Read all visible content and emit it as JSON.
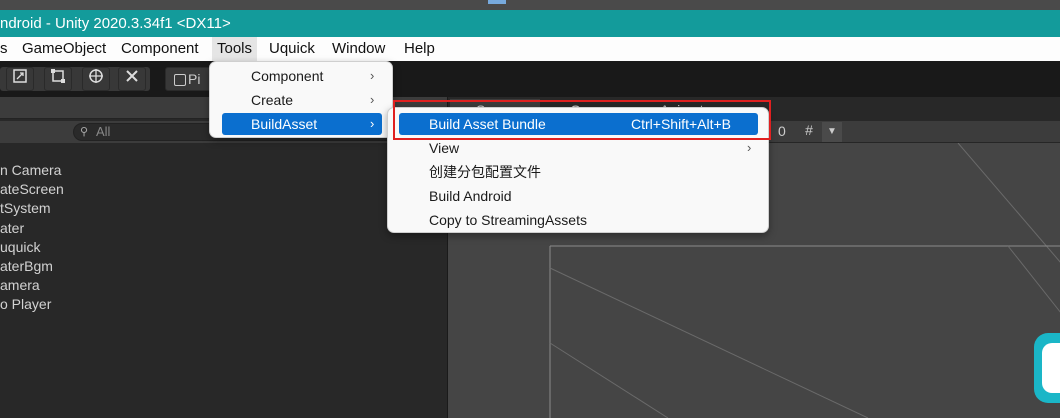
{
  "window": {
    "title": "ndroid - Unity 2020.3.34f1 <DX11>"
  },
  "menubar": {
    "items": [
      {
        "label": "s"
      },
      {
        "label": "GameObject"
      },
      {
        "label": "Component"
      },
      {
        "label": "Tools"
      },
      {
        "label": "Uquick"
      },
      {
        "label": "Window"
      },
      {
        "label": "Help"
      }
    ]
  },
  "toolbar": {
    "pivot_label": "Pi"
  },
  "hierarchy": {
    "search_placeholder": "All",
    "rows": [
      "n Camera",
      "ateScreen",
      "tSystem",
      "ater",
      "uquick",
      "aterBgm",
      "amera",
      "o Player"
    ]
  },
  "scene": {
    "tabs": [
      "Scene",
      "Game",
      "Animator"
    ],
    "gizmo_count": "0"
  },
  "tools_menu": {
    "items": [
      {
        "label": "Component",
        "arrow": "›"
      },
      {
        "label": "Create",
        "arrow": "›"
      },
      {
        "label": "BuildAsset",
        "arrow": "›"
      }
    ]
  },
  "buildasset_menu": {
    "items": [
      {
        "label": "Build Asset Bundle",
        "shortcut": "Ctrl+Shift+Alt+B"
      },
      {
        "label": "View",
        "arrow": "›"
      },
      {
        "label": "创建分包配置文件"
      },
      {
        "label": "Build Android"
      },
      {
        "label": "Copy to StreamingAssets"
      }
    ]
  },
  "colors": {
    "titlebar": "#139b9b",
    "selection": "#0b6fcf",
    "highlight": "#e02020"
  }
}
